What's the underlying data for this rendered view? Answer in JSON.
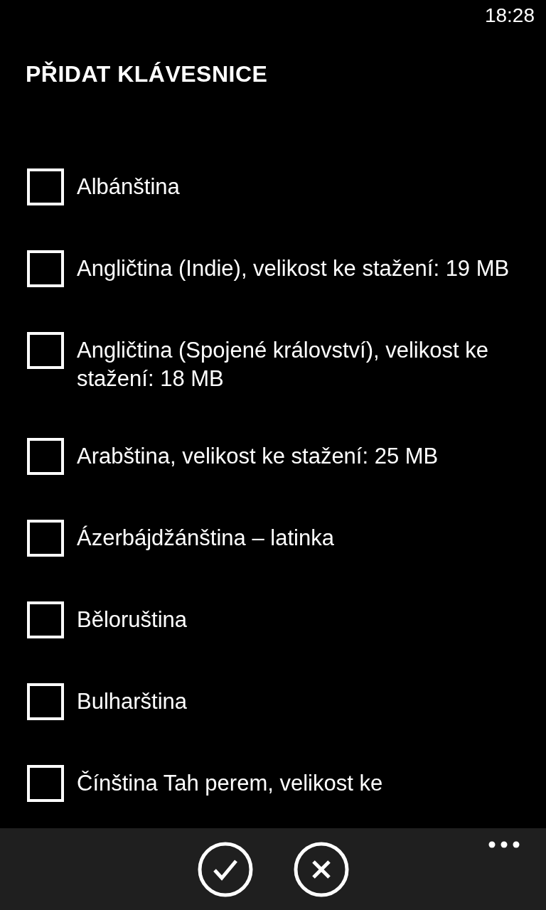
{
  "status_bar": {
    "time": "18:28"
  },
  "title": "PŘIDAT KLÁVESNICE",
  "items": [
    {
      "label": "Albánština",
      "checked": false
    },
    {
      "label": "Angličtina (Indie), velikost ke stažení: 19 MB",
      "checked": false
    },
    {
      "label": "Angličtina (Spojené království), velikost ke stažení: 18 MB",
      "checked": false
    },
    {
      "label": "Arabština, velikost ke stažení: 25 MB",
      "checked": false
    },
    {
      "label": "Ázerbájdžánština – latinka",
      "checked": false
    },
    {
      "label": "Běloruština",
      "checked": false
    },
    {
      "label": "Bulharština",
      "checked": false
    },
    {
      "label": "Čínština Tah perem, velikost ke",
      "checked": false
    }
  ],
  "app_bar": {
    "buttons": [
      {
        "kind": "confirm"
      },
      {
        "kind": "cancel"
      }
    ]
  }
}
